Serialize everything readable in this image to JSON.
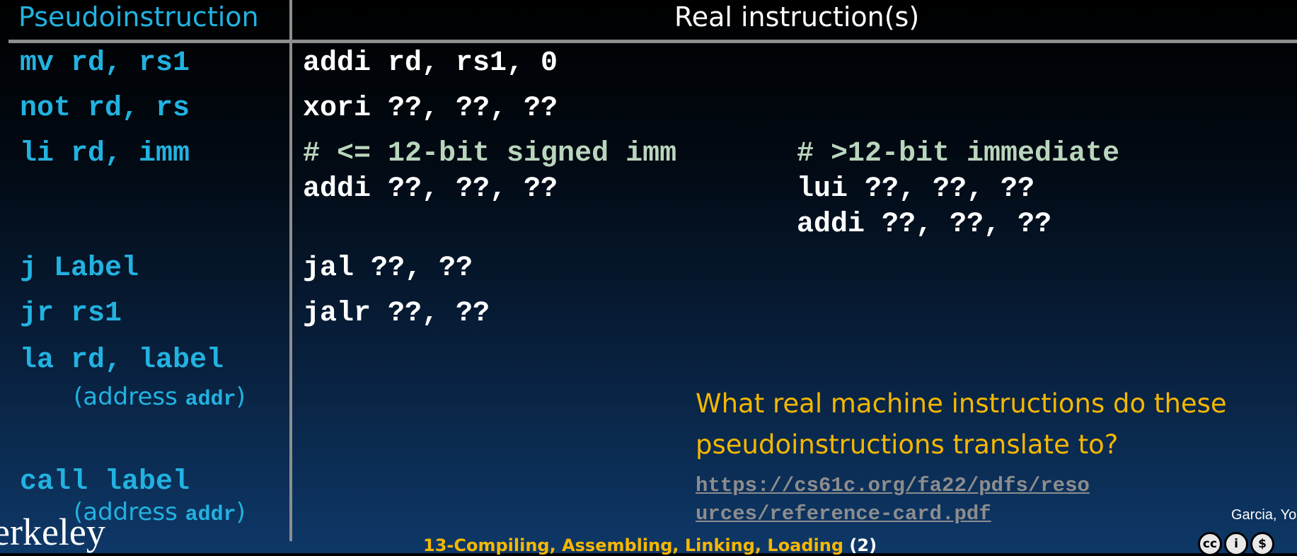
{
  "table": {
    "header_pseudo": "Pseudoinstruction",
    "header_real": "Real instruction(s)",
    "rows": [
      {
        "pseudo": "mv rd, rs1",
        "real": "addi rd, rs1, 0"
      },
      {
        "pseudo": "not rd, rs",
        "real": "xori ??, ??, ??"
      },
      {
        "pseudo": "li rd, imm",
        "comment_left": "# <= 12-bit signed imm",
        "real_left": "addi ??, ??, ??",
        "comment_right": "# >12-bit immediate",
        "real_right_1": "lui ??, ??, ??",
        "real_right_2": "addi ??, ??, ??"
      },
      {
        "pseudo": "j Label",
        "real": "jal ??, ??"
      },
      {
        "pseudo": "jr rs1",
        "real": "jalr ??, ??"
      },
      {
        "pseudo": "la rd, label",
        "note_pre": "(address ",
        "note_code": "addr",
        "note_post": ")"
      },
      {
        "pseudo": "call label",
        "note_pre": "(address ",
        "note_code": "addr",
        "note_post": ")"
      }
    ]
  },
  "question": "What real machine instructions do these pseudoinstructions translate to?",
  "link": "https://cs61c.org/fa22/pdfs/resources/reference-card.pdf",
  "footer": {
    "logo": "erkeley",
    "lecture": "13-Compiling, Assembling, Linking, Loading",
    "page": "(2)",
    "author": "Garcia, Yo"
  },
  "license_icons": [
    "cc-icon",
    "by-icon",
    "nc-icon"
  ]
}
